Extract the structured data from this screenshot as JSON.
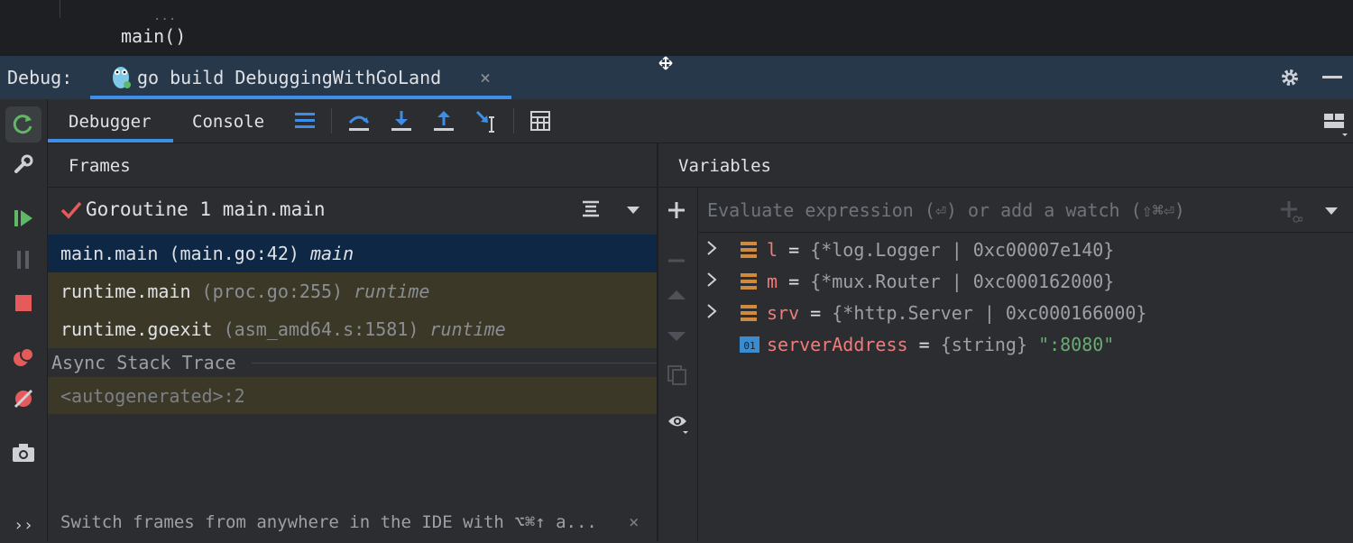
{
  "editor": {
    "code_line": "main()",
    "partial_above": "..."
  },
  "debug_header": {
    "label": "Debug:",
    "run_tab": {
      "title": "go build DebuggingWithGoLand",
      "close": "×",
      "icon": "gopher-icon"
    },
    "icons": [
      "gear-icon",
      "minimize-icon"
    ]
  },
  "left_toolbar": {
    "icons": [
      "rerun-icon",
      "wrench-icon",
      "resume-icon",
      "pause-icon",
      "stop-icon",
      "view-breakpoints-icon",
      "mute-breakpoints-icon",
      "camera-icon",
      "more-icon"
    ],
    "more": "››"
  },
  "sub_toolbar": {
    "tabs": [
      {
        "label": "Debugger",
        "active": true
      },
      {
        "label": "Console",
        "active": false
      }
    ],
    "actions": [
      "show-execution-point-icon",
      "step-over-icon",
      "step-into-icon",
      "step-out-icon",
      "run-to-cursor-icon",
      "evaluate-expression-icon",
      "layout-settings-icon"
    ]
  },
  "frames": {
    "title": "Frames",
    "goroutine": "Goroutine 1 main.main",
    "rows": [
      {
        "fn": "main.main",
        "loc": "(main.go:42)",
        "pkg": "main",
        "selected": true
      },
      {
        "fn": "runtime.main",
        "loc": "(proc.go:255)",
        "pkg": "runtime",
        "selected": false
      },
      {
        "fn": "runtime.goexit",
        "loc": "(asm_amd64.s:1581)",
        "pkg": "runtime",
        "selected": false
      }
    ],
    "async_label": "Async Stack Trace",
    "async_rows": [
      "<autogenerated>:2"
    ],
    "tip": "Switch frames from anywhere in the IDE with ⌥⌘↑ a...",
    "tip_close": "×"
  },
  "variables": {
    "title": "Variables",
    "eval_placeholder": "Evaluate expression (⏎) or add a watch (⇧⌘⏎)",
    "items": [
      {
        "name": "l",
        "eq": "=",
        "value": "{*log.Logger | 0xc00007e140}",
        "expandable": true,
        "icon": "field-icon"
      },
      {
        "name": "m",
        "eq": "=",
        "value": "{*mux.Router | 0xc000162000}",
        "expandable": true,
        "icon": "field-icon"
      },
      {
        "name": "srv",
        "eq": "=",
        "value": "{*http.Server | 0xc000166000}",
        "expandable": true,
        "icon": "field-icon"
      },
      {
        "name": "serverAddress",
        "eq": "=",
        "value": "{string}",
        "string_value": "\":8080\"",
        "expandable": false,
        "icon": "primitive-icon",
        "icon_text": "01"
      }
    ]
  },
  "colors": {
    "accent": "#3d8ee6",
    "selected_frame": "#0e2745",
    "library_frame": "#3b3828",
    "var_name": "#f07b7b",
    "string_value": "#6aab73",
    "resume_green": "#5fb865",
    "stop_red": "#e55b5b"
  }
}
